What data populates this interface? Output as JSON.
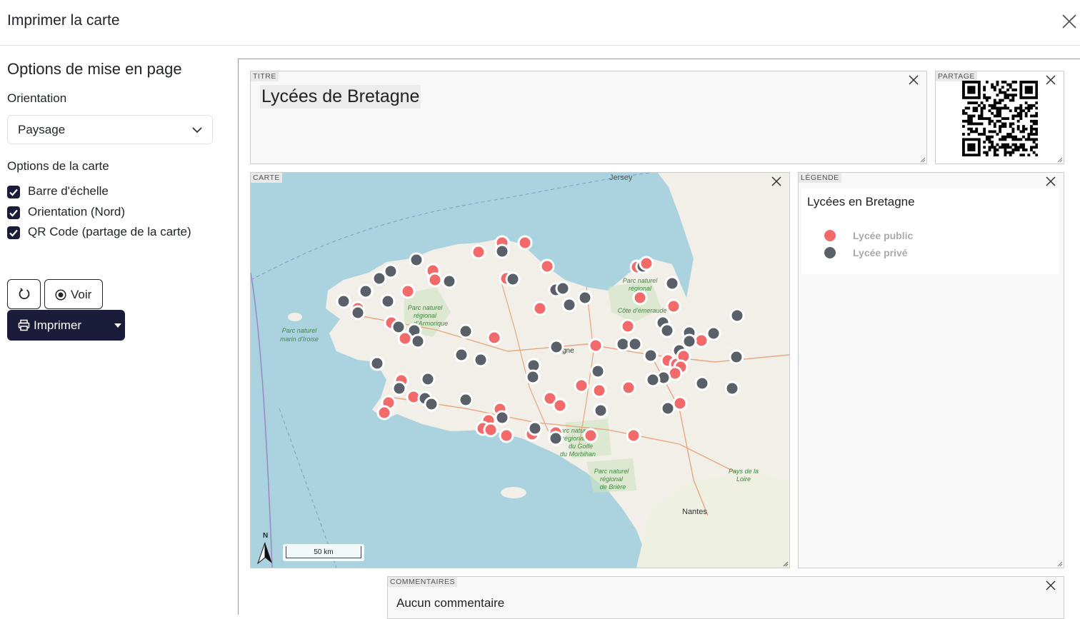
{
  "modal": {
    "title": "Imprimer la carte"
  },
  "sidebar": {
    "heading": "Options de mise en page",
    "orientation_label": "Orientation",
    "orientation_value": "Paysage",
    "map_options_label": "Options de la carte",
    "options": [
      {
        "label": "Barre d'échelle",
        "checked": true
      },
      {
        "label": "Orientation (Nord)",
        "checked": true
      },
      {
        "label": "QR Code (partage de la carte)",
        "checked": true
      }
    ],
    "view_label": "Voir",
    "print_label": "Imprimer"
  },
  "layout": {
    "title_tag": "TITRE",
    "title_text": "Lycées de Bretagne",
    "share_tag": "PARTAGE",
    "map_tag": "CARTE",
    "legend_tag": "LÉGENDE",
    "legend_title": "Lycées en Bretagne",
    "legend_items": [
      {
        "label": "Lycée public",
        "color": "#f36a6a"
      },
      {
        "label": "Lycée privé",
        "color": "#5a6068"
      }
    ],
    "comments_tag": "COMMENTAIRES",
    "comments_text": "Aucun commentaire"
  },
  "map": {
    "scale_label": "50 km",
    "north_label": "N",
    "place_labels": {
      "jersey": "Jersey",
      "nantes": "Nantes",
      "iroise": [
        "Parc naturel",
        "marin d'Iroise"
      ],
      "armorique": [
        "Parc naturel",
        "régional",
        "d'Armorique"
      ],
      "rance": [
        "Parc naturel",
        "régional",
        "Côte d'émeraude"
      ],
      "golfe": [
        "Parc naturel",
        "régional",
        "du Golfe",
        "du Morbihan"
      ],
      "briere": [
        "Parc naturel",
        "régional",
        "de Brière"
      ],
      "loire": [
        "Pays de la",
        "Loire"
      ],
      "bretagne_fragment": "gne"
    },
    "colors": {
      "sea": "#aad3df",
      "land": "#f2efe9",
      "public": "#f36a6a",
      "private": "#5a6068"
    }
  }
}
